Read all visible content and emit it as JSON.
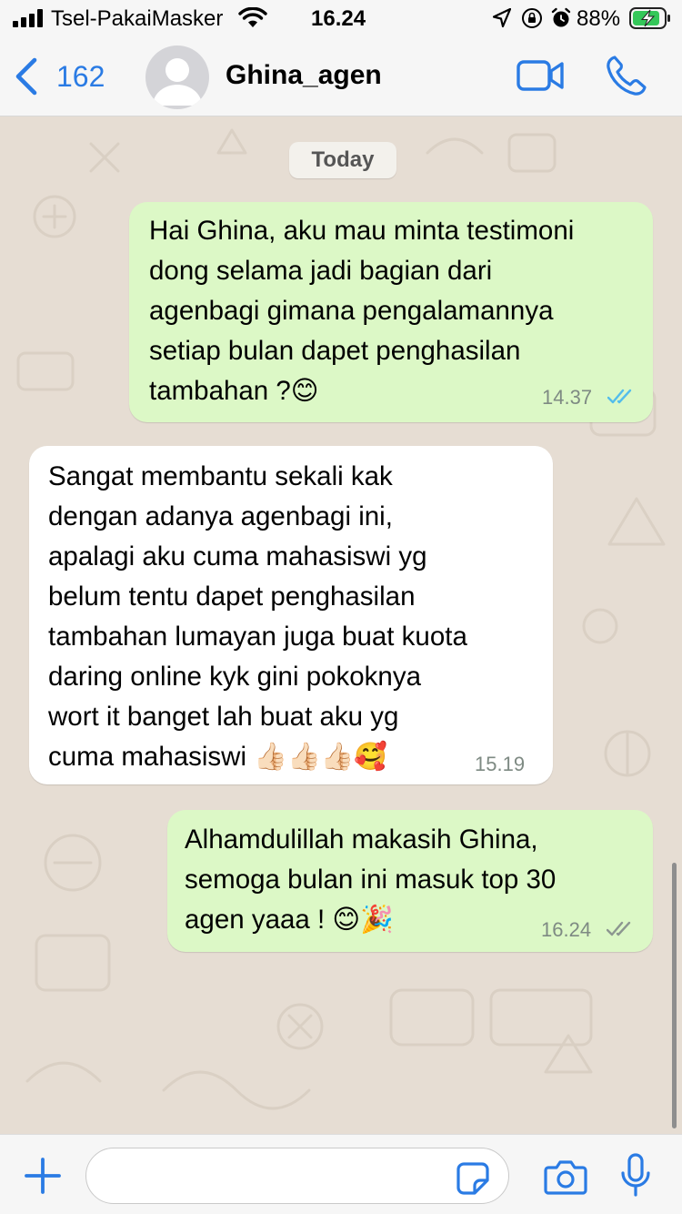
{
  "status_bar": {
    "carrier": "Tsel-PakaiMasker",
    "time": "16.24",
    "battery_percent": "88%",
    "battery_level": 0.88,
    "icons": [
      "signal-icon",
      "wifi-icon",
      "location-icon",
      "orientation-lock-icon",
      "alarm-icon",
      "battery-charging-icon"
    ]
  },
  "header": {
    "back_count": "162",
    "contact_name": "Ghina_agen",
    "icons": [
      "chevron-left-icon",
      "avatar-placeholder-icon",
      "video-call-icon",
      "phone-icon"
    ]
  },
  "chat": {
    "date_label": "Today",
    "messages": [
      {
        "direction": "outgoing",
        "text": "Hai Ghina, aku mau minta testimoni\ndong selama jadi bagian dari\nagenbagi gimana pengalamannya\nsetiap bulan dapet penghasilan\ntambahan ?😊",
        "time": "14.37",
        "status": "read"
      },
      {
        "direction": "incoming",
        "text": "Sangat membantu sekali kak\ndengan adanya agenbagi ini,\napalagi aku cuma mahasiswi yg\nbelum tentu dapet penghasilan\ntambahan lumayan juga buat kuota\ndaring online kyk gini pokoknya\nwort it banget lah buat aku yg\ncuma mahasiswi 👍🏻👍🏻👍🏻🥰",
        "time": "15.19"
      },
      {
        "direction": "outgoing",
        "text": "Alhamdulillah makasih Ghina,\nsemoga bulan ini masuk top 30\nagen yaaa ! 😊🎉",
        "time": "16.24",
        "status": "delivered"
      }
    ]
  },
  "input_bar": {
    "placeholder": "",
    "value": "",
    "icons": [
      "plus-icon",
      "sticker-icon",
      "camera-icon",
      "microphone-icon"
    ]
  },
  "colors": {
    "accent": "#2a7be4",
    "outgoing_bubble": "#dcf8c6",
    "incoming_bubble": "#ffffff",
    "chat_background": "#e6ddd3",
    "read_ticks": "#53bdeb",
    "delivered_ticks": "#8c9690"
  }
}
